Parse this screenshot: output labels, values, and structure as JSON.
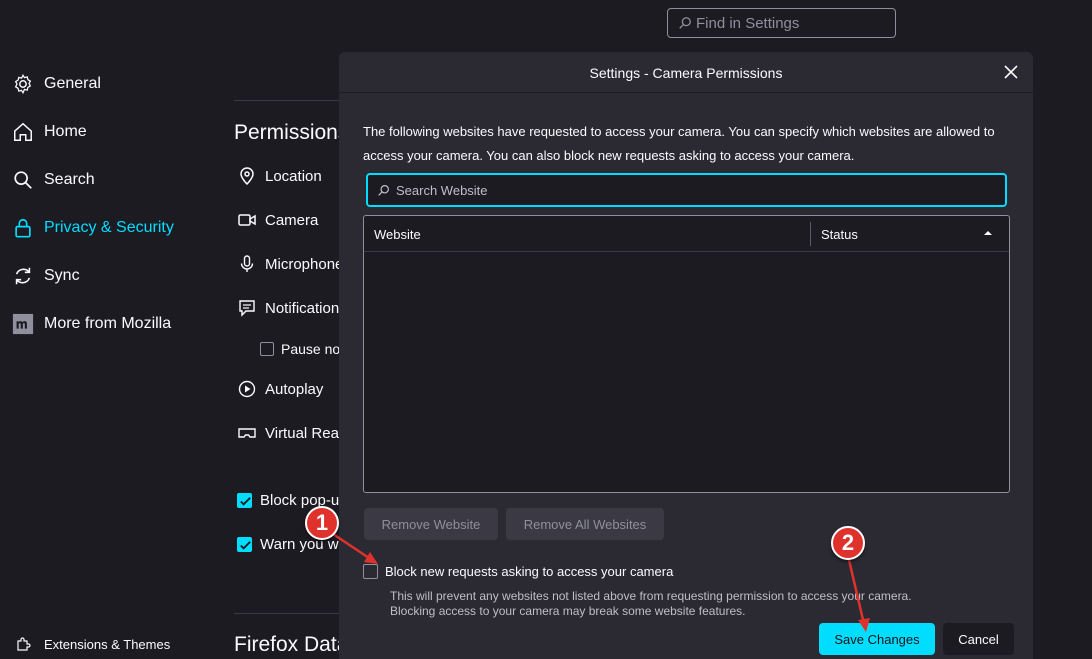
{
  "find": {
    "placeholder": "Find in Settings",
    "icon": "search-icon"
  },
  "sidebar": {
    "items": [
      {
        "label": "General",
        "icon": "gear-icon"
      },
      {
        "label": "Home",
        "icon": "home-icon"
      },
      {
        "label": "Search",
        "icon": "search-icon"
      },
      {
        "label": "Privacy & Security",
        "icon": "lock-icon",
        "selected": true
      },
      {
        "label": "Sync",
        "icon": "sync-icon"
      },
      {
        "label": "More from Mozilla",
        "icon": "mozilla-icon"
      }
    ],
    "footer": {
      "label": "Extensions & Themes",
      "icon": "puzzle-icon"
    }
  },
  "main": {
    "permissions_title": "Permissions",
    "permissions": [
      {
        "label": "Location",
        "icon": "location-icon"
      },
      {
        "label": "Camera",
        "icon": "camera-icon"
      },
      {
        "label": "Microphone",
        "icon": "microphone-icon"
      },
      {
        "label": "Notifications",
        "icon": "notification-icon"
      }
    ],
    "pause_label": "Pause no",
    "autoplay_label": "Autoplay",
    "vr_label": "Virtual Real",
    "block_popups_label": "Block pop-u",
    "warn_label": "Warn you w",
    "data_title": "Firefox Data"
  },
  "dialog": {
    "title": "Settings - Camera Permissions",
    "description": "The following websites have requested to access your camera. You can specify which websites are allowed to access your camera. You can also block new requests asking to access your camera.",
    "search_placeholder": "Search Website",
    "columns": {
      "website": "Website",
      "status": "Status"
    },
    "rows": [],
    "remove_website": "Remove Website",
    "remove_all": "Remove All Websites",
    "block_label": "Block new requests asking to access your camera",
    "block_checked": false,
    "note_line1": "This will prevent any websites not listed above from requesting permission to access your camera.",
    "note_line2": "Blocking access to your camera may break some website features.",
    "save": "Save Changes",
    "cancel": "Cancel"
  },
  "annotations": {
    "one": "1",
    "two": "2"
  },
  "colors": {
    "accent": "#00ddff",
    "background": "#1c1b22",
    "dialog": "#2b2a33",
    "annotation": "#e0322c"
  }
}
